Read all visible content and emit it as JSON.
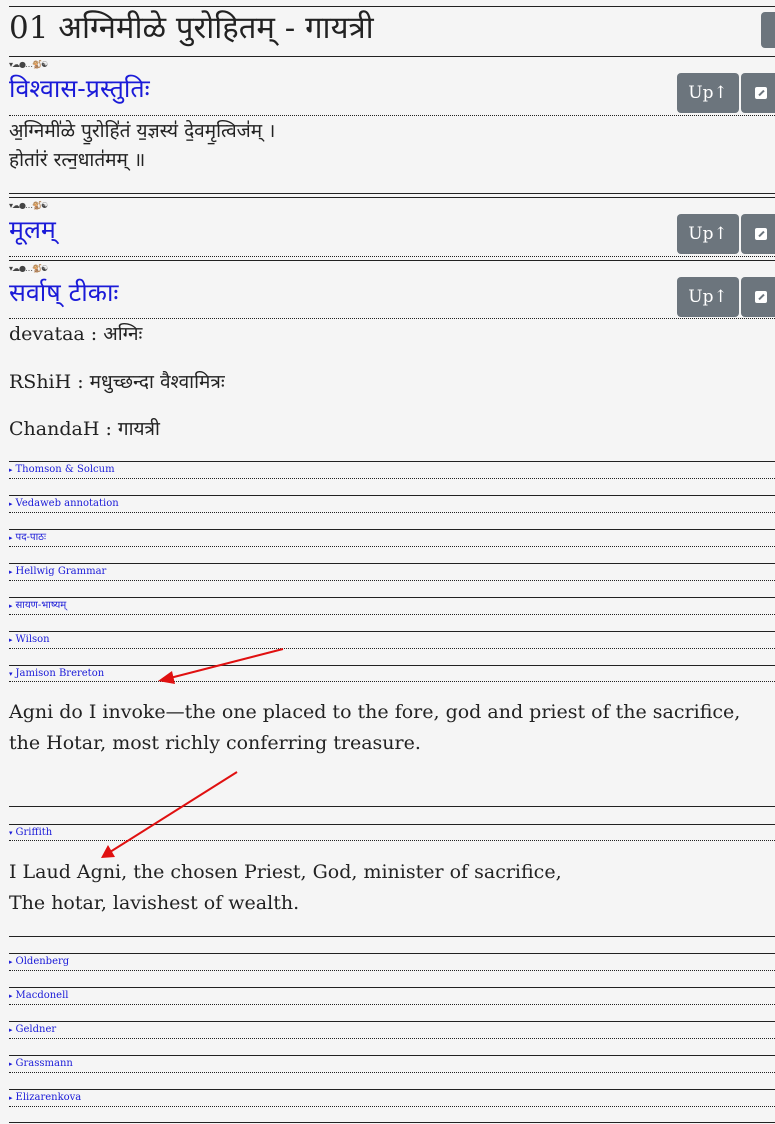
{
  "header": {
    "title": "01  अग्निमीळे पुरोहितम् - गायत्री"
  },
  "section_icons": "▾☁●…🐒☯",
  "buttons": {
    "up_label": "Up↑"
  },
  "sections": {
    "vishvasa": {
      "title": "विश्वास-प्रस्तुतिः",
      "verse_line1": "अ॒ग्निमी॑ळे पु॒रोहि॑तं य॒ज्ञस्य॑ दे॒वमृ॒त्विज॑म् ।",
      "verse_line2": "होता॑रं रत्न॒धात॑मम् ॥"
    },
    "mulam": {
      "title": "मूलम्"
    },
    "tika": {
      "title": "सर्वाष् टीकाः",
      "devataa": "devataa : अग्निः",
      "rshi": "RShiH : मधुच्छन्दा वैश्वामित्रः",
      "chandah": "ChandaH : गायत्री"
    }
  },
  "collapsed": {
    "thomson": "Thomson & Solcum",
    "vedaweb": "Vedaweb annotation",
    "padapatha": "पद-पाठः",
    "hellwig": "Hellwig Grammar",
    "sayana": "सायण-भाष्यम्",
    "wilson": "Wilson",
    "oldenberg": "Oldenberg",
    "macdonell": "Macdonell",
    "geldner": "Geldner",
    "grassmann": "Grassmann",
    "elizarenkova": "Elizarenkova"
  },
  "expanded": {
    "jamison": {
      "label": "Jamison Brereton",
      "text": "Agni do I invoke—the one placed to the fore, god and priest of the sacrifice,\nthe Hotar, most richly conferring treasure."
    },
    "griffith": {
      "label": "Griffith",
      "text": "I Laud Agni, the chosen Priest, God, minister of sacrifice,\nThe hotar, lavishest of wealth."
    }
  },
  "colors": {
    "link_blue": "#1a1ad8",
    "button_gray": "#6c757d",
    "annotation_arrow": "#e01010"
  },
  "carets": {
    "closed": "▸",
    "open": "▾"
  }
}
